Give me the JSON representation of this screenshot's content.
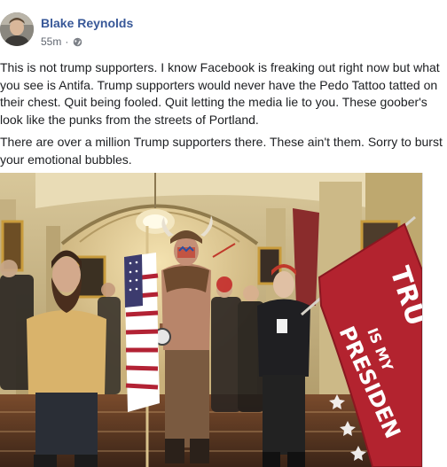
{
  "post": {
    "author": "Blake Reynolds",
    "time": "55m",
    "separator": "·",
    "paragraphs": [
      "This is not trump supporters. I know Facebook is freaking out right now but what",
      "you see is Antifa. Trump supporters would never have the Pedo Tattoo tatted on",
      "their chest. Quit being fooled. Quit letting the media lie to you. These goober's",
      "look like the punks from the streets of Portland.",
      "There are over a million Trump supporters there. These ain't them. Sorry to burst",
      "your emotional bubbles."
    ],
    "photo_flag_text": [
      "TRU",
      "IS MY",
      "PRESIDEN"
    ]
  },
  "colors": {
    "author_link": "#385898",
    "meta_gray": "#616770",
    "flag_red": "#b3232f"
  },
  "icons": {
    "privacy": "globe-icon"
  }
}
